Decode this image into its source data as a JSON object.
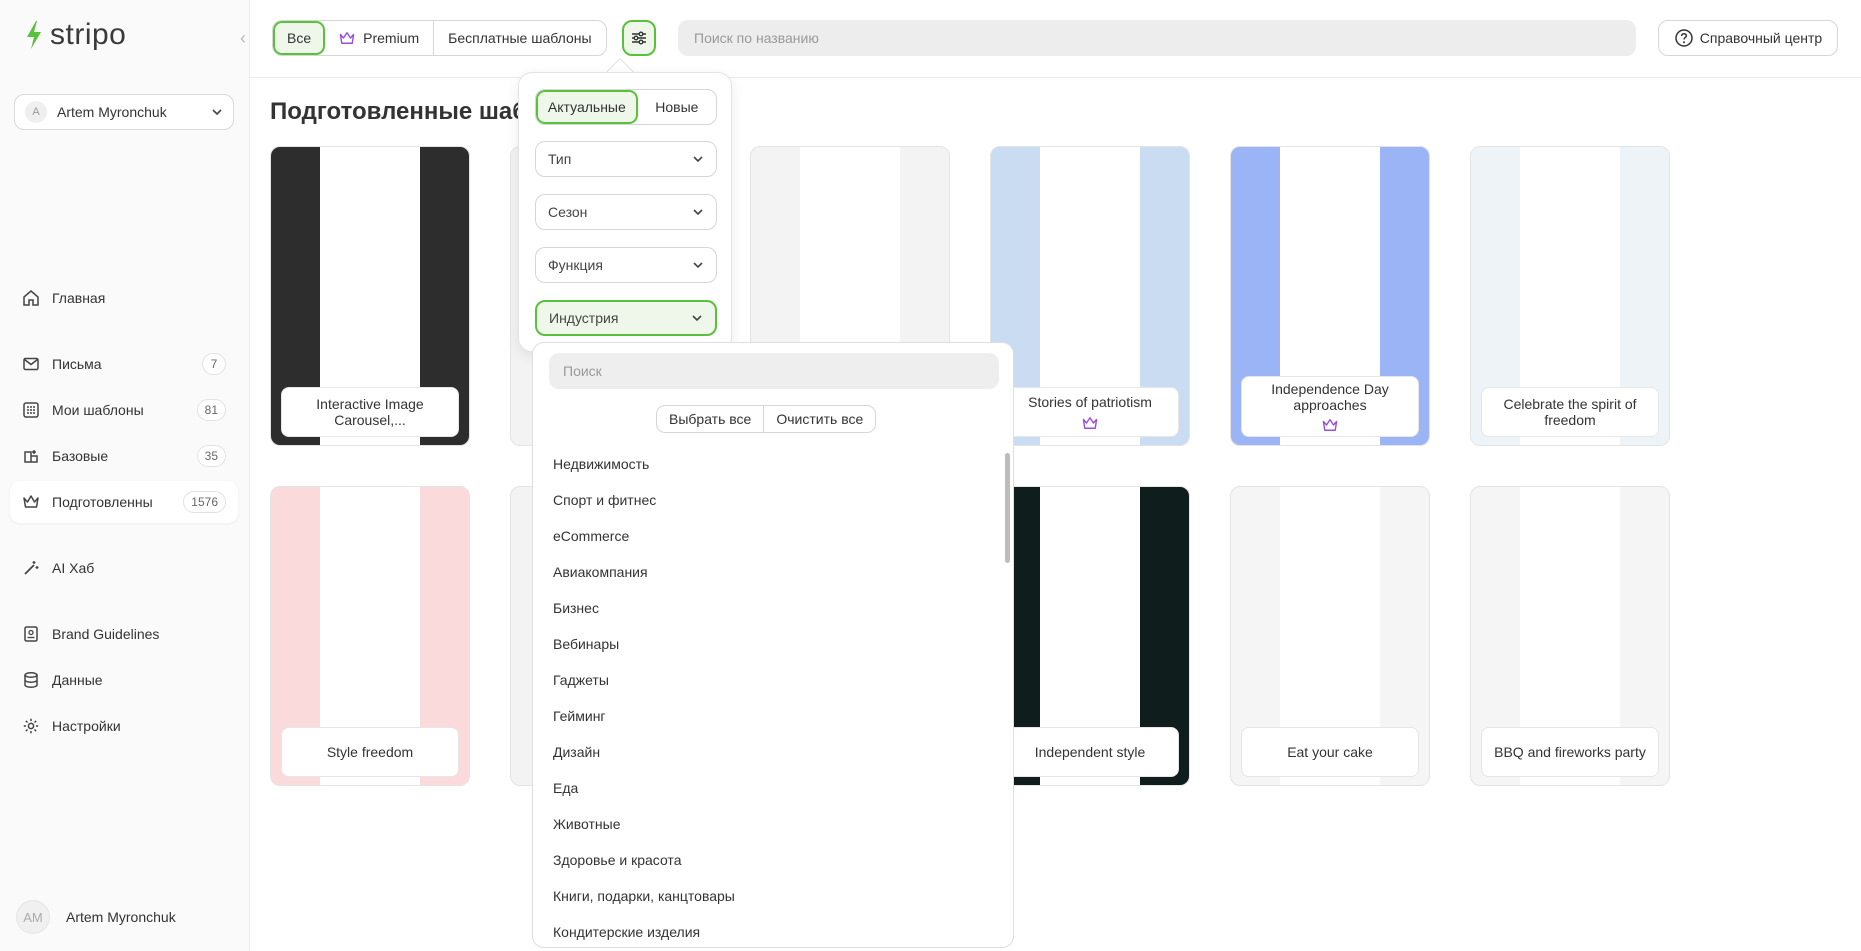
{
  "brand": {
    "name": "stripo",
    "accent": "#58c23b"
  },
  "account": {
    "initial": "A",
    "name": "Artem Myronchuk"
  },
  "nav": [
    {
      "label": "Главная",
      "icon": "home-icon",
      "badge": ""
    },
    {
      "label": "Письма",
      "icon": "mail-icon",
      "badge": "7"
    },
    {
      "label": "Мои шаблоны",
      "icon": "grid-icon",
      "badge": "81"
    },
    {
      "label": "Базовые",
      "icon": "layers-icon",
      "badge": "35"
    },
    {
      "label": "Подготовленны",
      "icon": "crown-icon",
      "badge": "1576"
    },
    {
      "label": "AI Хаб",
      "icon": "magic-wand-icon",
      "badge": ""
    },
    {
      "label": "Brand Guidelines",
      "icon": "brand-book-icon",
      "badge": ""
    },
    {
      "label": "Данные",
      "icon": "database-icon",
      "badge": ""
    },
    {
      "label": "Настройки",
      "icon": "gear-icon",
      "badge": ""
    }
  ],
  "footer_user": {
    "initials": "AM",
    "name": "Artem Myronchuk"
  },
  "topbar": {
    "segments": [
      "Все",
      "Premium",
      "Бесплатные шаблоны"
    ],
    "search_placeholder": "Поиск по названию",
    "help": "Справочный центр"
  },
  "page_title": "Подготовленные шаб",
  "filter": {
    "toggle": [
      "Актуальные",
      "Новые"
    ],
    "dropdowns": [
      "Тип",
      "Сезон",
      "Функция",
      "Индустрия"
    ]
  },
  "industry": {
    "search_placeholder": "Поиск",
    "select_all": "Выбрать все",
    "clear_all": "Очистить все",
    "options": [
      "Недвижимость",
      "Спорт и фитнес",
      "eCommerce",
      "Авиакомпания",
      "Бизнес",
      "Вебинары",
      "Гаджеты",
      "Гейминг",
      "Дизайн",
      "Еда",
      "Животные",
      "Здоровье и красота",
      "Книги, подарки, канцтовары",
      "Кондитерские изделия"
    ]
  },
  "cards": [
    {
      "label": "Interactive Image Carousel,...",
      "premium": false,
      "bg": "#2d2d2d"
    },
    {
      "label": "",
      "premium": false,
      "bg": "#f3f3f3"
    },
    {
      "label": "",
      "premium": false,
      "bg": "#f3f3f3"
    },
    {
      "label": "Stories of patriotism",
      "premium": true,
      "bg": "#c9dcf2"
    },
    {
      "label": "Independence Day approaches",
      "premium": true,
      "bg": "#9ab4f5"
    },
    {
      "label": "Celebrate the spirit of freedom",
      "premium": false,
      "bg": "#eef3f7"
    },
    {
      "label": "Style freedom",
      "premium": false,
      "bg": "#fadada"
    },
    {
      "label": "",
      "premium": false,
      "bg": "#f3f3f3"
    },
    {
      "label": "",
      "premium": false,
      "bg": "#f3f3f3"
    },
    {
      "label": "Independent style",
      "premium": false,
      "bg": "#0f1d1c"
    },
    {
      "label": "Eat your cake",
      "premium": false,
      "bg": "#f5f5f5"
    },
    {
      "label": "BBQ and fireworks party",
      "premium": false,
      "bg": "#f5f5f5"
    }
  ]
}
